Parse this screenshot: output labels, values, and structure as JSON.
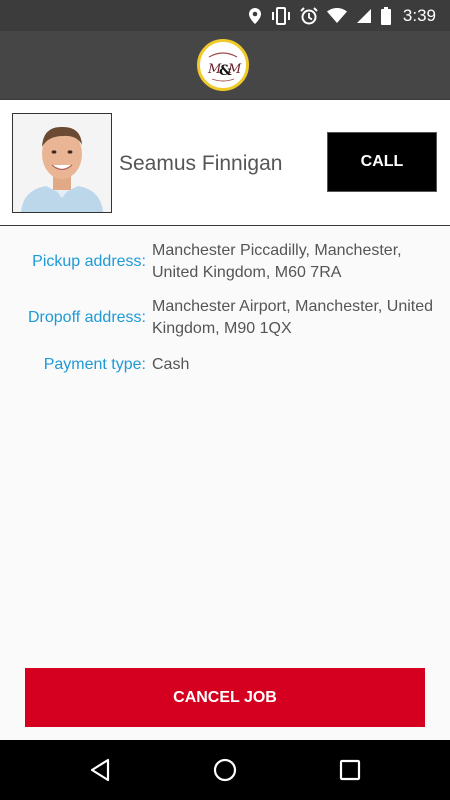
{
  "status_bar": {
    "time": "3:39",
    "icons": [
      "location-icon",
      "vibrate-icon",
      "alarm-icon",
      "wifi-icon",
      "signal-icon",
      "battery-icon"
    ]
  },
  "app_bar": {
    "logo_icon": "mm-logo-icon"
  },
  "driver": {
    "name": "Seamus Finnigan",
    "call_label": "CALL"
  },
  "details": {
    "pickup_label": "Pickup address:",
    "pickup_value": "Manchester Piccadilly, Manchester, United Kingdom, M60 7RA",
    "dropoff_label": "Dropoff address:",
    "dropoff_value": "Manchester Airport, Manchester, United Kingdom, M90 1QX",
    "payment_label": "Payment type:",
    "payment_value": "Cash"
  },
  "actions": {
    "cancel_label": "CANCEL JOB"
  },
  "nav_bar": {
    "icons": [
      "back-icon",
      "home-icon",
      "recents-icon"
    ]
  },
  "colors": {
    "status_bar": "#3c3c3c",
    "app_bar": "#464646",
    "label_blue": "#1e9ad6",
    "cancel_red": "#d50020",
    "call_black": "#000000"
  }
}
